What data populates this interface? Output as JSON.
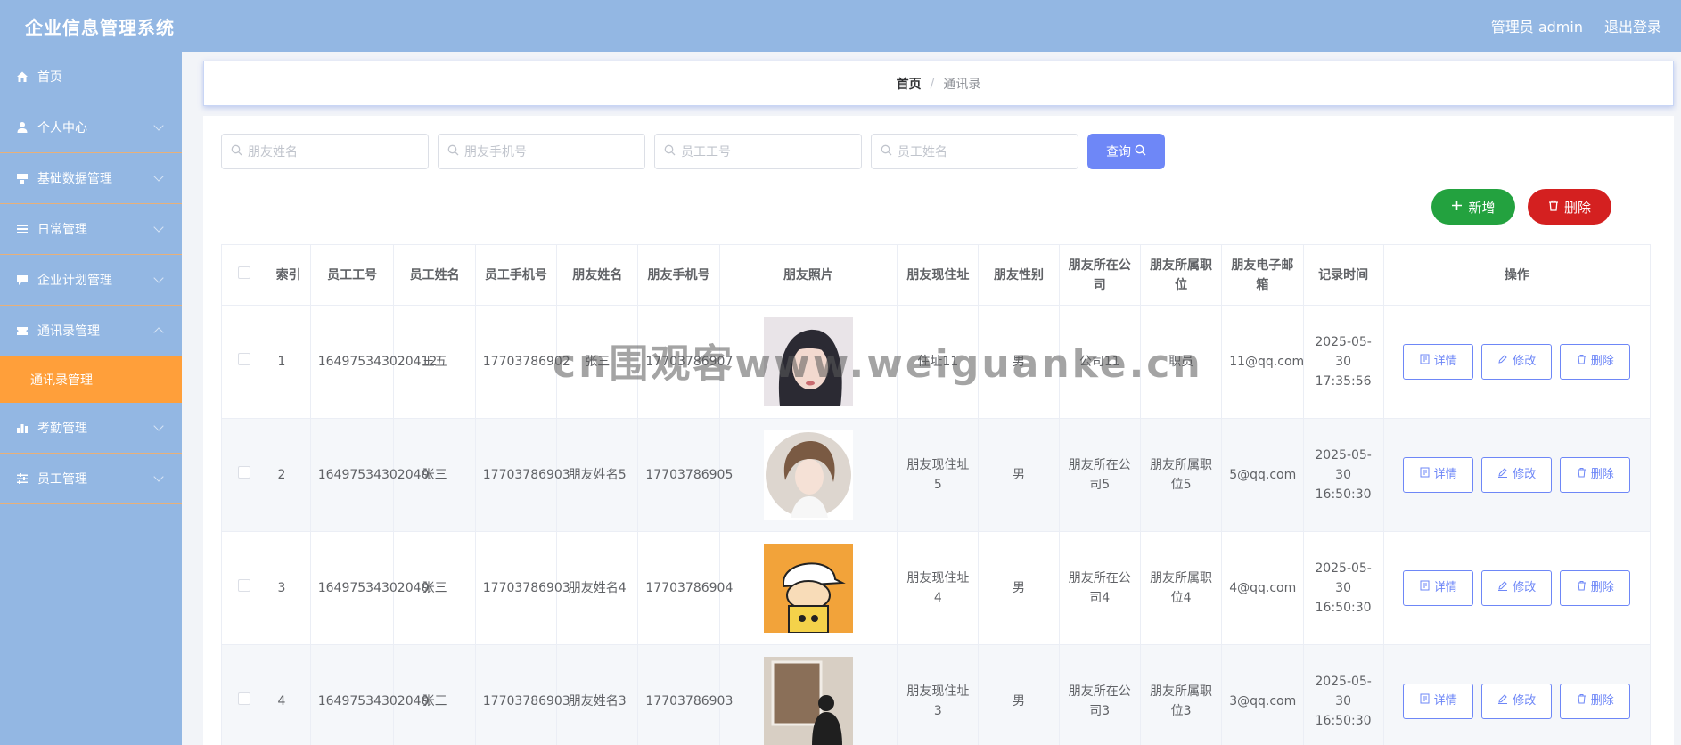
{
  "header": {
    "title": "企业信息管理系统",
    "user": "管理员 admin",
    "logout": "退出登录"
  },
  "sidebar": {
    "items": [
      {
        "label": "首页",
        "icon": "home-icon"
      },
      {
        "label": "个人中心",
        "icon": "user-icon"
      },
      {
        "label": "基础数据管理",
        "icon": "data-icon"
      },
      {
        "label": "日常管理",
        "icon": "list-icon"
      },
      {
        "label": "企业计划管理",
        "icon": "chat-icon"
      },
      {
        "label": "通讯录管理",
        "icon": "ticket-icon"
      },
      {
        "label": "考勤管理",
        "icon": "chart-icon"
      },
      {
        "label": "员工管理",
        "icon": "sliders-icon"
      }
    ],
    "active_sub": "通讯录管理"
  },
  "breadcrumb": {
    "home": "首页",
    "sep": "/",
    "current": "通讯录"
  },
  "search": {
    "friend_name": "朋友姓名",
    "friend_phone": "朋友手机号",
    "emp_no": "员工工号",
    "emp_name": "员工姓名",
    "query_label": "查询"
  },
  "actions": {
    "add": "新增",
    "delete": "删除"
  },
  "table": {
    "headers": [
      "索引",
      "员工工号",
      "员工姓名",
      "员工手机号",
      "朋友姓名",
      "朋友手机号",
      "朋友照片",
      "朋友现住址",
      "朋友性别",
      "朋友所在公司",
      "朋友所属职位",
      "朋友电子邮箱",
      "记录时间",
      "操作"
    ],
    "rows": [
      {
        "idx": "1",
        "emp_no": "164975343020412",
        "emp_name": "王五",
        "emp_phone": "17703786902",
        "friend_name": "张三",
        "friend_phone": "17703786907",
        "address": "住址11",
        "gender": "男",
        "company": "公司11",
        "position": "职员",
        "email": "11@qq.com",
        "time": "2025-05-30 17:35:56"
      },
      {
        "idx": "2",
        "emp_no": "16497534302040",
        "emp_name": "张三",
        "emp_phone": "17703786903",
        "friend_name": "朋友姓名5",
        "friend_phone": "17703786905",
        "address": "朋友现住址5",
        "gender": "男",
        "company": "朋友所在公司5",
        "position": "朋友所属职位5",
        "email": "5@qq.com",
        "time": "2025-05-30 16:50:30"
      },
      {
        "idx": "3",
        "emp_no": "16497534302040",
        "emp_name": "张三",
        "emp_phone": "17703786903",
        "friend_name": "朋友姓名4",
        "friend_phone": "17703786904",
        "address": "朋友现住址4",
        "gender": "男",
        "company": "朋友所在公司4",
        "position": "朋友所属职位4",
        "email": "4@qq.com",
        "time": "2025-05-30 16:50:30"
      },
      {
        "idx": "4",
        "emp_no": "16497534302040",
        "emp_name": "张三",
        "emp_phone": "17703786903",
        "friend_name": "朋友姓名3",
        "friend_phone": "17703786903",
        "address": "朋友现住址3",
        "gender": "男",
        "company": "朋友所在公司3",
        "position": "朋友所属职位3",
        "email": "3@qq.com",
        "time": "2025-05-30 16:50:30"
      }
    ],
    "op_labels": {
      "detail": "详情",
      "edit": "修改",
      "delete": "删除"
    }
  },
  "watermark": "cn围观客www.weiguanke.cn",
  "colors": {
    "topbar": "#93b7e3",
    "active": "#ff9f3a",
    "primary": "#6e87f7",
    "success": "#23a23f",
    "danger": "#d42020"
  }
}
